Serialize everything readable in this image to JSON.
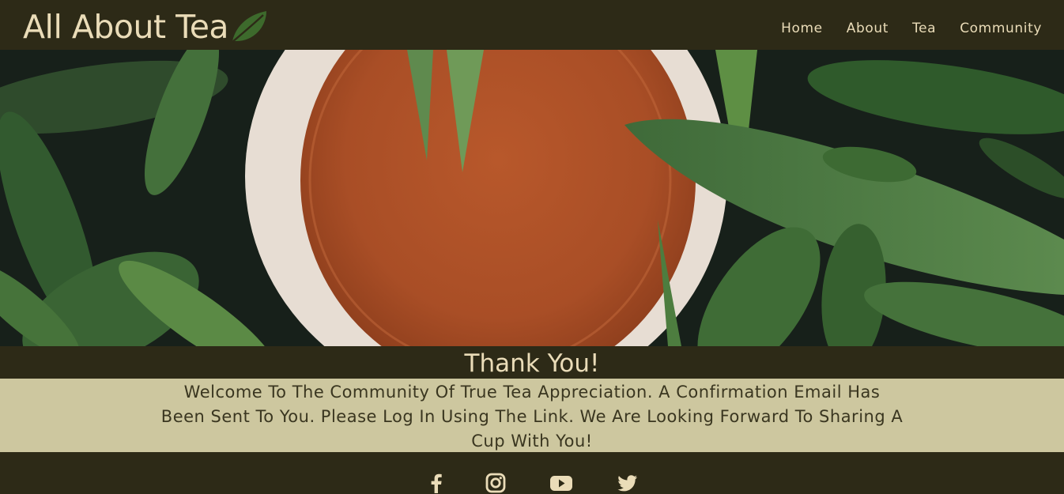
{
  "header": {
    "brand_title": "All About Tea",
    "logo_icon": "tea-leaf-icon",
    "nav": [
      {
        "label": "Home"
      },
      {
        "label": "About"
      },
      {
        "label": "Tea"
      },
      {
        "label": "Community"
      }
    ]
  },
  "hero": {
    "image": "cup-of-tea-among-green-leaves"
  },
  "main": {
    "title": "Thank You!",
    "message": "Welcome To The Community Of True Tea Appreciation. A Confirmation Email Has Been Sent To You. Please Log In Using The Link. We Are Looking Forward To Sharing A Cup With You!"
  },
  "footer": {
    "social": [
      {
        "name": "facebook-icon"
      },
      {
        "name": "instagram-icon"
      },
      {
        "name": "youtube-icon"
      },
      {
        "name": "twitter-icon"
      }
    ]
  },
  "colors": {
    "dark": "#2d2a17",
    "cream": "#eadcb8",
    "message_bg": "#cdc79f",
    "message_text": "#3a3620",
    "leaf": "#3e6a2e"
  }
}
